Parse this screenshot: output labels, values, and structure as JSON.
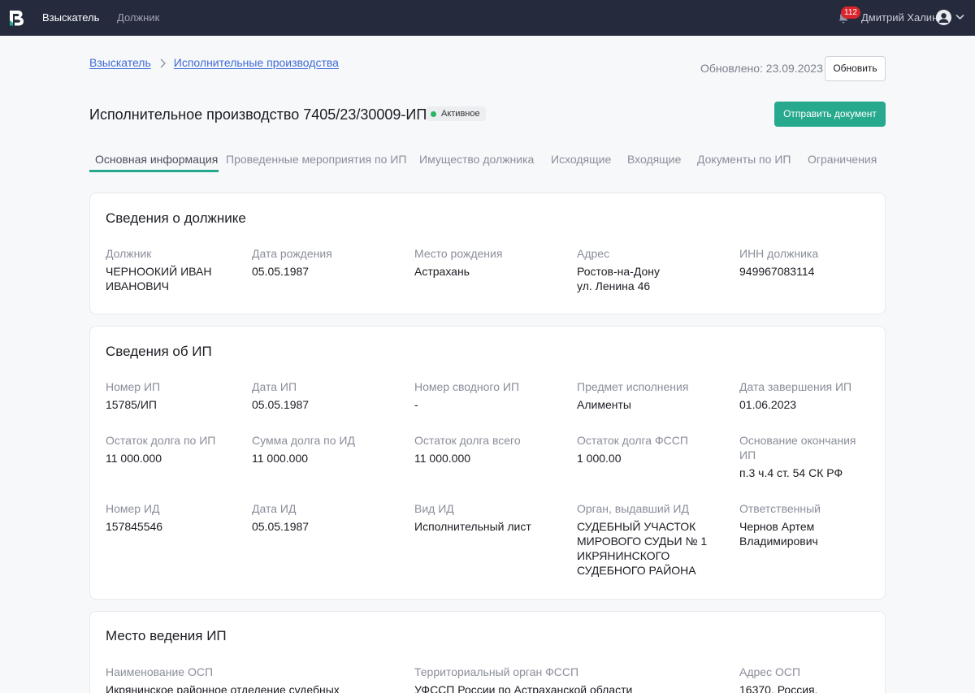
{
  "header": {
    "nav": [
      "Взыскатель",
      "Должник"
    ],
    "notifications_count": "112",
    "user_name": "Дмитрий Халин"
  },
  "breadcrumb": [
    "Взыскатель",
    "Исполнительные производства"
  ],
  "updated": "Обновлено: 23.09.2023",
  "refresh_label": "Обновить",
  "title": "Исполнительное производство 7405/23/30009-ИП",
  "status": "Активное",
  "send_label": "Отправить документ",
  "tabs": [
    "Основная информация",
    "Проведенные мероприятия по ИП",
    "Имущество должника",
    "Исходящие",
    "Входящие",
    "Документы по ИП",
    "Ограничения"
  ],
  "colors": {
    "topbar": "#262a3d",
    "accent": "#27a98d",
    "link": "#3f6ad8",
    "badge": "#d9262c",
    "status_dot": "#2bb566"
  },
  "debtor": {
    "title": "Сведения о должнике",
    "fields": [
      {
        "label": "Должник",
        "value": "ЧЕРНООКИЙ ИВАН\nИВАНОВИЧ"
      },
      {
        "label": "Дата рождения",
        "value": "05.05.1987"
      },
      {
        "label": "Место рождения",
        "value": "Астрахань"
      },
      {
        "label": "Адрес",
        "value": "Ростов-на-Дону\nул. Ленина 46"
      },
      {
        "label": "ИНН должника",
        "value": "949967083114"
      }
    ]
  },
  "ip": {
    "title": "Сведения об ИП",
    "rows": [
      [
        {
          "label": "Номер ИП",
          "value": "15785/ИП"
        },
        {
          "label": "Дата ИП",
          "value": "05.05.1987"
        },
        {
          "label": "Номер сводного ИП",
          "value": "-"
        },
        {
          "label": "Предмет исполнения",
          "value": "Алименты"
        },
        {
          "label": "Дата завершения ИП",
          "value": "01.06.2023"
        }
      ],
      [
        {
          "label": "Остаток долга по ИП",
          "value": "11 000.000"
        },
        {
          "label": "Сумма долга по ИД",
          "value": "11 000.000"
        },
        {
          "label": "Остаток долга всего",
          "value": "11 000.000"
        },
        {
          "label": "Остаток долга ФССП",
          "value": "1 000.00"
        },
        {
          "label": "Основание окончания\nИП",
          "value": "п.3 ч.4 ст. 54 СК РФ"
        }
      ],
      [
        {
          "label": "Номер ИД",
          "value": "157845546"
        },
        {
          "label": "Дата ИД",
          "value": "05.05.1987"
        },
        {
          "label": "Вид ИД",
          "value": "Исполнительный лист"
        },
        {
          "label": "Орган, выдавший ИД",
          "value": "СУДЕБНЫЙ УЧАСТОК\nМИРОВОГО СУДЬИ № 1\nИКРЯНИНСКОГО\nСУДЕБНОГО РАЙОНА"
        },
        {
          "label": "Ответственный",
          "value": "Чернов Артем\nВладимирович"
        }
      ]
    ]
  },
  "place": {
    "title": "Место ведения ИП",
    "fields": [
      {
        "label": "Наименование ОСП",
        "value": "Икрянинское районное отделение судебных"
      },
      {
        "label": "Территориальный орган ФССП",
        "value": "УФССП России по Астраханской области"
      },
      {
        "label": "Адрес ОСП",
        "value": "16370, Россия,"
      }
    ]
  }
}
